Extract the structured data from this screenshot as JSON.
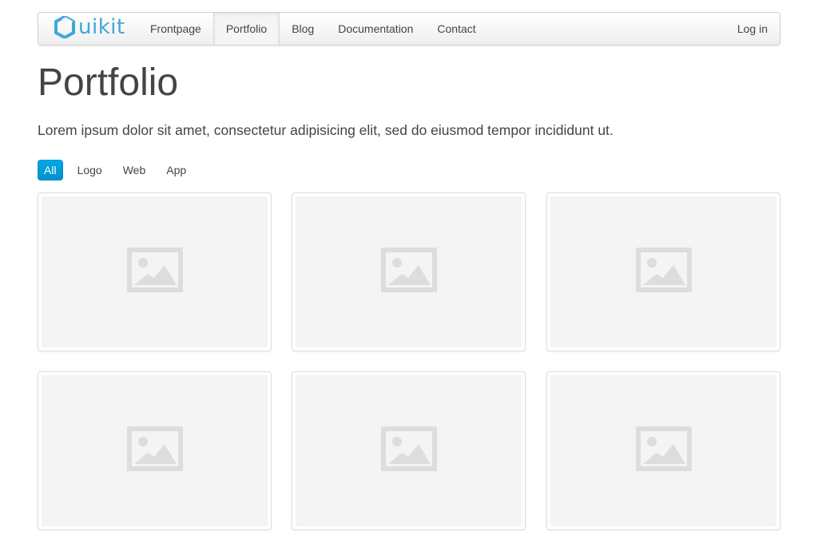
{
  "brand": {
    "name": "uikit",
    "color": "#3fa8d8"
  },
  "nav": {
    "items": [
      {
        "label": "Frontpage",
        "active": false
      },
      {
        "label": "Portfolio",
        "active": true
      },
      {
        "label": "Blog",
        "active": false
      },
      {
        "label": "Documentation",
        "active": false
      },
      {
        "label": "Contact",
        "active": false
      }
    ],
    "login_label": "Log in"
  },
  "main": {
    "title": "Portfolio",
    "lead": "Lorem ipsum dolor sit amet, consectetur adipisicing elit, sed do eiusmod tempor incididunt ut."
  },
  "filters": [
    {
      "label": "All",
      "active": true
    },
    {
      "label": "Logo",
      "active": false
    },
    {
      "label": "Web",
      "active": false
    },
    {
      "label": "App",
      "active": false
    }
  ],
  "accent_color": "#009dd8",
  "portfolio": {
    "items": [
      {
        "icon": "image-placeholder-icon"
      },
      {
        "icon": "image-placeholder-icon"
      },
      {
        "icon": "image-placeholder-icon"
      },
      {
        "icon": "image-placeholder-icon"
      },
      {
        "icon": "image-placeholder-icon"
      },
      {
        "icon": "image-placeholder-icon"
      }
    ]
  }
}
